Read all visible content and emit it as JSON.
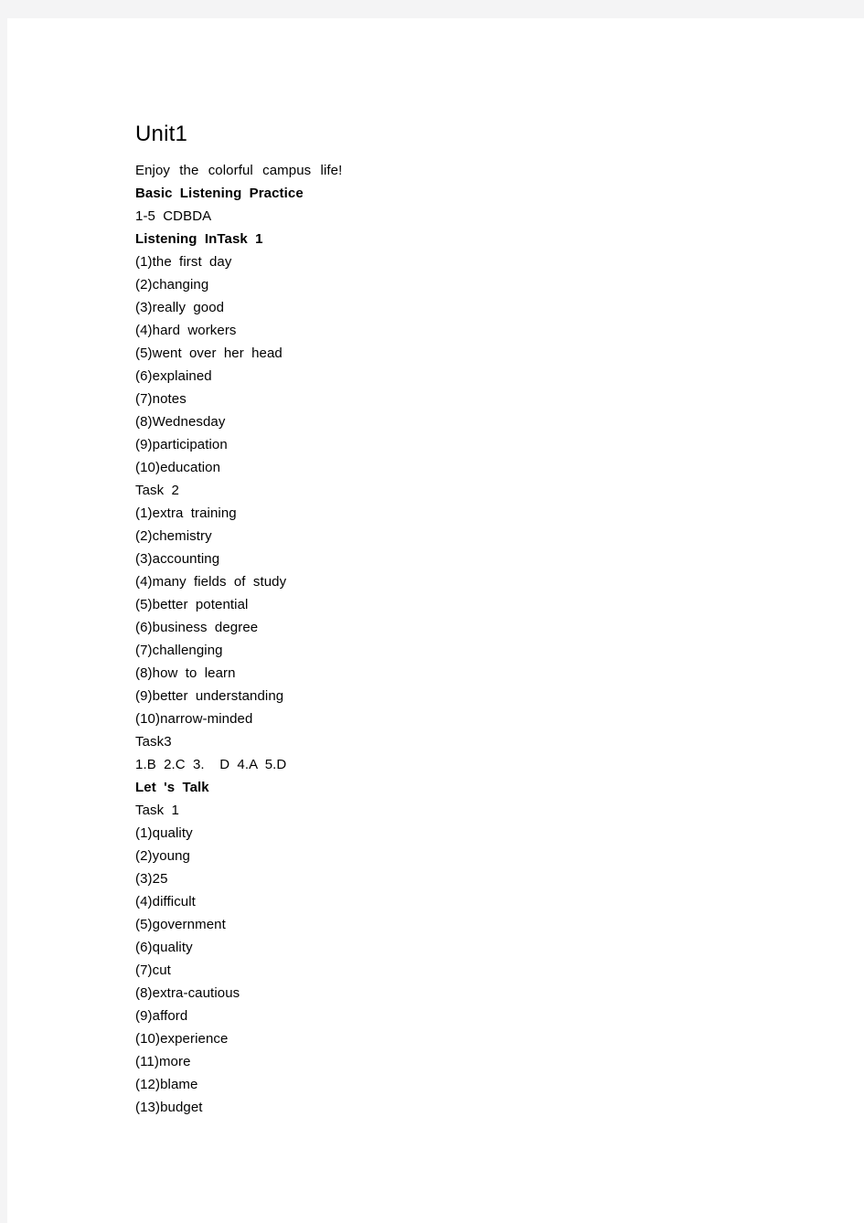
{
  "document": {
    "title": "Unit1",
    "lines": [
      {
        "text": "Enjoy the colorful campus life!",
        "style": "spaced-wide",
        "bold": false
      },
      {
        "text": "Basic Listening Practice",
        "style": "spaced",
        "bold": true
      },
      {
        "text": "1-5 CDBDA",
        "style": "spaced",
        "bold": false
      },
      {
        "text": "Listening InTask 1",
        "style": "spaced",
        "bold": true
      },
      {
        "text": "(1)the first day",
        "style": "spaced",
        "bold": false
      },
      {
        "text": "(2)changing",
        "style": "none",
        "bold": false
      },
      {
        "text": "(3)really good",
        "style": "spaced",
        "bold": false
      },
      {
        "text": "(4)hard workers",
        "style": "spaced",
        "bold": false
      },
      {
        "text": "(5)went over her head",
        "style": "spaced",
        "bold": false
      },
      {
        "text": "(6)explained",
        "style": "none",
        "bold": false
      },
      {
        "text": "(7)notes",
        "style": "none",
        "bold": false
      },
      {
        "text": "(8)Wednesday",
        "style": "none",
        "bold": false
      },
      {
        "text": "(9)participation",
        "style": "none",
        "bold": false
      },
      {
        "text": "(10)education",
        "style": "none",
        "bold": false
      },
      {
        "text": "Task 2",
        "style": "spaced",
        "bold": false
      },
      {
        "text": "(1)extra training",
        "style": "spaced",
        "bold": false
      },
      {
        "text": "(2)chemistry",
        "style": "none",
        "bold": false
      },
      {
        "text": "(3)accounting",
        "style": "none",
        "bold": false
      },
      {
        "text": "(4)many fields of study",
        "style": "spaced",
        "bold": false
      },
      {
        "text": "(5)better potential",
        "style": "spaced",
        "bold": false
      },
      {
        "text": "(6)business degree",
        "style": "spaced",
        "bold": false
      },
      {
        "text": "(7)challenging",
        "style": "none",
        "bold": false
      },
      {
        "text": "(8)how to learn",
        "style": "spaced",
        "bold": false
      },
      {
        "text": "(9)better understanding",
        "style": "spaced",
        "bold": false
      },
      {
        "text": "(10)narrow-minded",
        "style": "none",
        "bold": false
      },
      {
        "text": "Task3",
        "style": "none",
        "bold": false
      },
      {
        "text": "1.B 2.C 3.  D 4.A 5.D",
        "style": "spaced",
        "bold": false
      },
      {
        "text": "Let 's Talk",
        "style": "spaced",
        "bold": true
      },
      {
        "text": "Task 1",
        "style": "spaced",
        "bold": false
      },
      {
        "text": "(1)quality",
        "style": "none",
        "bold": false
      },
      {
        "text": "(2)young",
        "style": "none",
        "bold": false
      },
      {
        "text": "(3)25",
        "style": "none",
        "bold": false
      },
      {
        "text": "(4)difficult",
        "style": "none",
        "bold": false
      },
      {
        "text": "(5)government",
        "style": "none",
        "bold": false
      },
      {
        "text": "(6)quality",
        "style": "none",
        "bold": false
      },
      {
        "text": "(7)cut",
        "style": "none",
        "bold": false
      },
      {
        "text": "(8)extra-cautious",
        "style": "none",
        "bold": false
      },
      {
        "text": "(9)afford",
        "style": "none",
        "bold": false
      },
      {
        "text": "(10)experience",
        "style": "none",
        "bold": false
      },
      {
        "text": "(11)more",
        "style": "none",
        "bold": false
      },
      {
        "text": "(12)blame",
        "style": "none",
        "bold": false
      },
      {
        "text": "(13)budget",
        "style": "none",
        "bold": false
      }
    ]
  }
}
